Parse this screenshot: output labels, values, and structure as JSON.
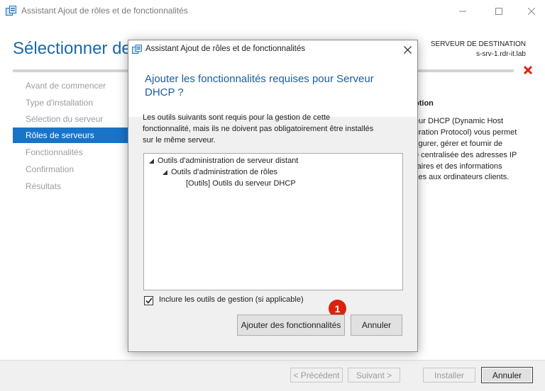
{
  "window": {
    "title": "Assistant Ajout de rôles et de fonctionnalités",
    "controls": {
      "minimize_icon": "minimize-icon",
      "maximize_icon": "maximize-icon",
      "close_icon": "close-icon"
    }
  },
  "header": {
    "page_title": "Sélectionner des",
    "destination_label": "SERVEUR DE DESTINATION",
    "destination_server": "s-srv-1.rdr-it.lab",
    "error_icon": "error-x-icon"
  },
  "sidebar": {
    "items": [
      {
        "label": "Avant de commencer",
        "active": false
      },
      {
        "label": "Type d'installation",
        "active": false
      },
      {
        "label": "Sélection du serveur",
        "active": false
      },
      {
        "label": "Rôles de serveurs",
        "active": true
      },
      {
        "label": "Fonctionnalités",
        "active": false
      },
      {
        "label": "Confirmation",
        "active": false
      },
      {
        "label": "Résultats",
        "active": false
      }
    ]
  },
  "description": {
    "heading": "ption",
    "lines": [
      "eur DHCP (Dynamic Host",
      "uration Protocol) vous permet",
      "figurer, gérer et fournir de",
      "e centralisée des adresses IP",
      "raires et des informations",
      "xes aux ordinateurs clients."
    ]
  },
  "footer": {
    "previous": "< Précédent",
    "next": "Suivant >",
    "install": "Installer",
    "cancel": "Annuler"
  },
  "dialog": {
    "title": "Assistant Ajout de rôles et de fonctionnalités",
    "heading_line1": "Ajouter les fonctionnalités requises pour Serveur",
    "heading_line2": "DHCP ?",
    "description_lines": [
      "Les outils suivants sont requis pour la gestion de cette",
      "fonctionnalité, mais ils ne doivent pas obligatoirement être installés",
      "sur le même serveur."
    ],
    "tree": [
      {
        "label": "Outils d'administration de serveur distant",
        "level": 0,
        "expanded": true
      },
      {
        "label": "Outils d'administration de rôles",
        "level": 1,
        "expanded": true
      },
      {
        "label": "[Outils] Outils du serveur DHCP",
        "level": 2,
        "expanded": false
      }
    ],
    "include_tools_label": "Inclure les outils de gestion (si applicable)",
    "include_tools_checked": true,
    "add_features_button": "Ajouter des fonctionnalités",
    "cancel_button": "Annuler",
    "step_badge": "1"
  }
}
